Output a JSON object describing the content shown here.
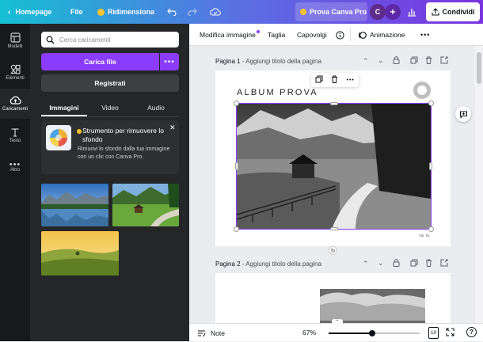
{
  "topbar": {
    "home_label": "Homepage",
    "file_label": "File",
    "resize_label": "Ridimensiona",
    "pro_label": "Prova Canva Pro",
    "avatar_initial": "C",
    "share_label": "Condividi"
  },
  "rail": {
    "items": [
      {
        "label": "Modelli",
        "icon": "template-icon"
      },
      {
        "label": "Elementi",
        "icon": "elements-icon"
      },
      {
        "label": "Caricamenti",
        "icon": "upload-cloud-icon"
      },
      {
        "label": "Testo",
        "icon": "text-icon"
      },
      {
        "label": "Altro",
        "icon": "more-icon"
      }
    ]
  },
  "panel": {
    "search_placeholder": "Cerca caricamenti",
    "upload_label": "Carica file",
    "register_label": "Registrati",
    "tabs": [
      {
        "label": "Immagini"
      },
      {
        "label": "Video"
      },
      {
        "label": "Audio"
      }
    ],
    "promo": {
      "title": "Strumento per rimuovere lo sfondo",
      "text": "Rimuovi lo sfondo dalla tua immagine con un clic con Canva Pro."
    }
  },
  "toolbar": {
    "edit_image": "Modifica immagine",
    "crop": "Taglia",
    "flip": "Capovolgi",
    "animation": "Animazione"
  },
  "pages": [
    {
      "label": "Pagina 1",
      "title_placeholder": "Aggiungi titolo della pagina",
      "heading": "ALBUM PROVA",
      "footnote": "Vol. 01"
    },
    {
      "label": "Pagina 2",
      "title_placeholder": "Aggiungi titolo della pagina"
    }
  ],
  "footer": {
    "notes_label": "Note",
    "zoom": "67%",
    "page_count": "10"
  },
  "colors": {
    "accent": "#8b3dff",
    "selection": "#8b3dff",
    "panel_bg": "#252627",
    "rail_bg": "#18191b"
  }
}
